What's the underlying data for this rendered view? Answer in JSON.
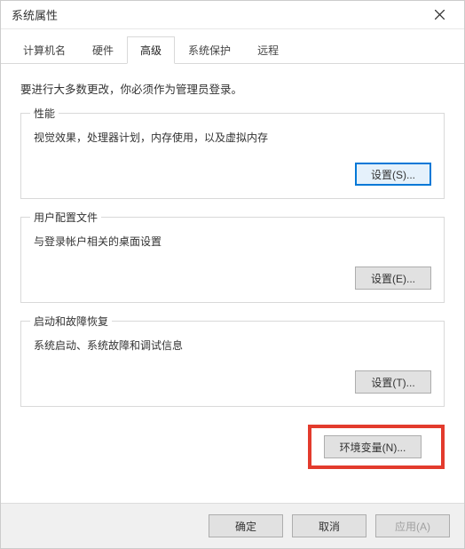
{
  "window": {
    "title": "系统属性"
  },
  "tabs": {
    "computer_name": "计算机名",
    "hardware": "硬件",
    "advanced": "高级",
    "system_protection": "系统保护",
    "remote": "远程"
  },
  "content": {
    "intro": "要进行大多数更改，你必须作为管理员登录。",
    "performance": {
      "title": "性能",
      "desc": "视觉效果，处理器计划，内存使用，以及虚拟内存",
      "button": "设置(S)..."
    },
    "user_profiles": {
      "title": "用户配置文件",
      "desc": "与登录帐户相关的桌面设置",
      "button": "设置(E)..."
    },
    "startup": {
      "title": "启动和故障恢复",
      "desc": "系统启动、系统故障和调试信息",
      "button": "设置(T)..."
    },
    "env_button": "环境变量(N)..."
  },
  "footer": {
    "ok": "确定",
    "cancel": "取消",
    "apply": "应用(A)"
  }
}
